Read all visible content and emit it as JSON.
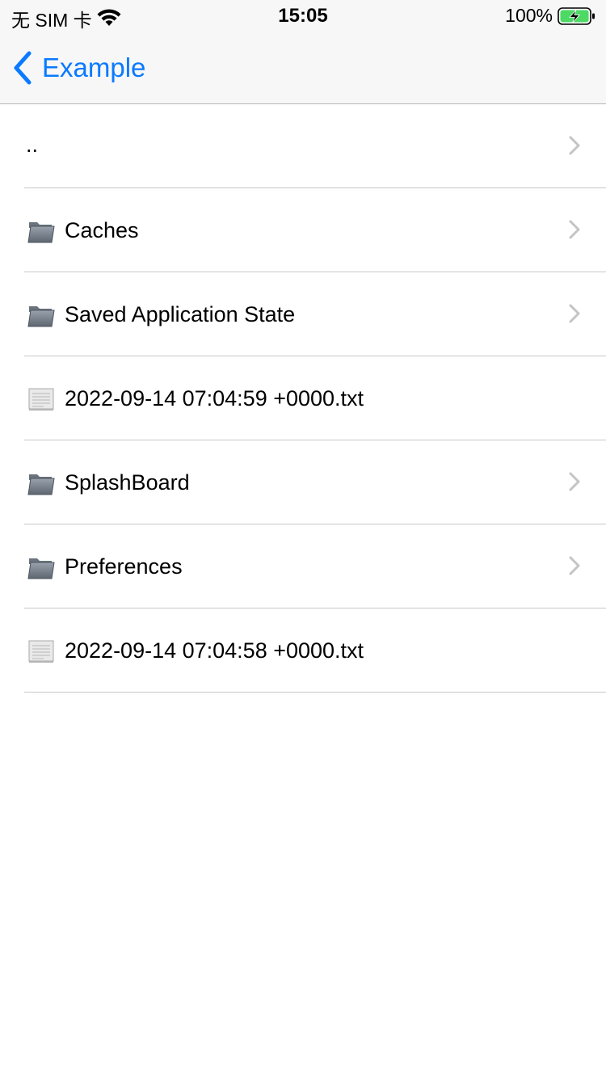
{
  "status_bar": {
    "carrier": "无 SIM 卡",
    "time": "15:05",
    "battery_percent": "100%",
    "wifi_icon": "wifi-icon",
    "battery_icon": "battery-charging-icon"
  },
  "nav": {
    "back_label": "Example",
    "back_icon": "chevron-left-icon",
    "accent_color": "#0a7aff"
  },
  "rows": [
    {
      "label": "..",
      "kind": "parent",
      "icon": "none",
      "chevron": true
    },
    {
      "label": "Caches",
      "kind": "folder",
      "icon": "folder-icon",
      "chevron": true
    },
    {
      "label": "Saved Application State",
      "kind": "folder",
      "icon": "folder-icon",
      "chevron": true
    },
    {
      "label": "2022-09-14 07:04:59 +0000.txt",
      "kind": "file",
      "icon": "document-icon",
      "chevron": false
    },
    {
      "label": "SplashBoard",
      "kind": "folder",
      "icon": "folder-icon",
      "chevron": true
    },
    {
      "label": "Preferences",
      "kind": "folder",
      "icon": "folder-icon",
      "chevron": true
    },
    {
      "label": "2022-09-14 07:04:58 +0000.txt",
      "kind": "file",
      "icon": "document-icon",
      "chevron": false
    }
  ]
}
